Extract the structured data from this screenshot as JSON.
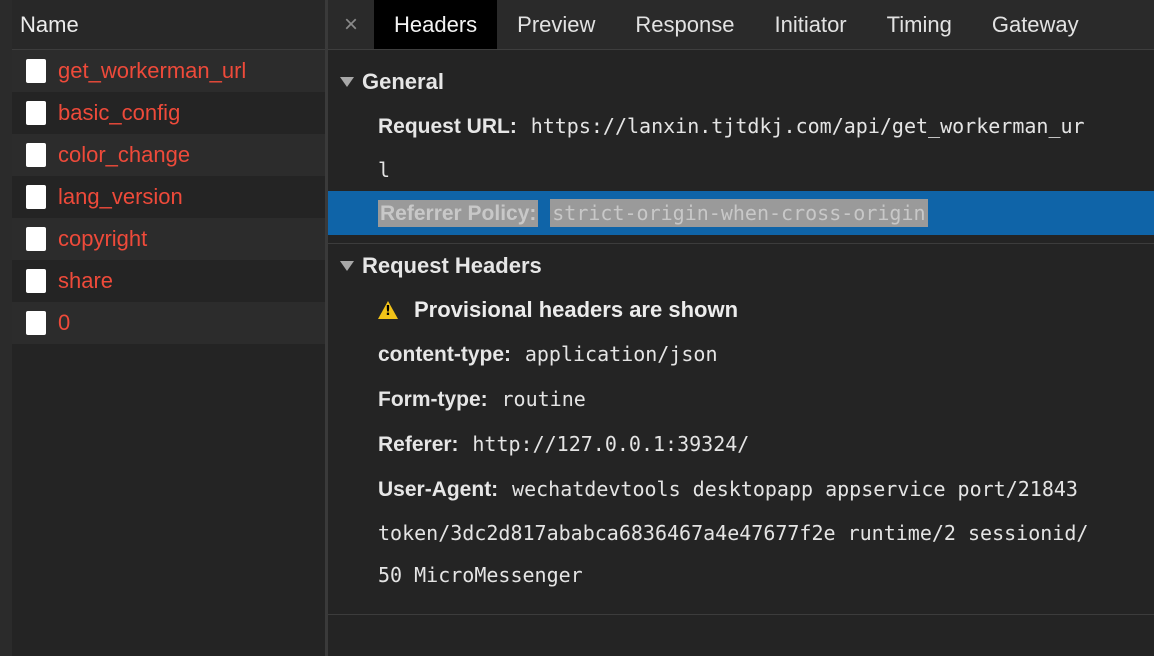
{
  "name_panel": {
    "header": "Name",
    "requests": [
      {
        "label": "get_workerman_url"
      },
      {
        "label": "basic_config"
      },
      {
        "label": "color_change"
      },
      {
        "label": "lang_version"
      },
      {
        "label": "copyright"
      },
      {
        "label": "share"
      },
      {
        "label": "0"
      }
    ]
  },
  "tabs": {
    "close_glyph": "×",
    "items": [
      {
        "label": "Headers",
        "active": true
      },
      {
        "label": "Preview"
      },
      {
        "label": "Response"
      },
      {
        "label": "Initiator"
      },
      {
        "label": "Timing"
      },
      {
        "label": "Gateway"
      }
    ]
  },
  "general": {
    "title": "General",
    "request_url_key": "Request URL:",
    "request_url_value": "https://lanxin.tjtdkj.com/api/get_workerman_ur",
    "request_url_cont": "l",
    "referrer_policy_key": "Referrer Policy:",
    "referrer_policy_value": "strict-origin-when-cross-origin"
  },
  "request_headers": {
    "title": "Request Headers",
    "warning": "Provisional headers are shown",
    "rows": [
      {
        "key": "content-type:",
        "value": "application/json"
      },
      {
        "key": "Form-type:",
        "value": "routine"
      },
      {
        "key": "Referer:",
        "value": "http://127.0.0.1:39324/"
      },
      {
        "key": "User-Agent:",
        "value": "wechatdevtools desktopapp appservice port/21843"
      }
    ],
    "ua_cont_1": "token/3dc2d817ababca6836467a4e47677f2e runtime/2 sessionid/",
    "ua_cont_2": "50 MicroMessenger"
  },
  "colors": {
    "request_name": "#ee4a3a",
    "highlight_row": "#0f64a8",
    "warning_icon": "#f2c318"
  }
}
